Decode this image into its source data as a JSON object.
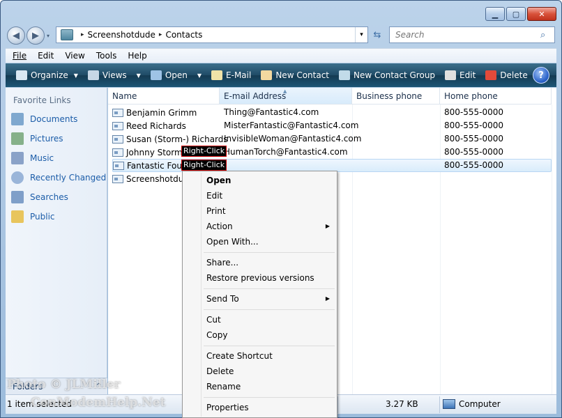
{
  "window": {
    "caption_buttons": {
      "minimize": "▁",
      "maximize": "▢",
      "close": "✕"
    }
  },
  "nav": {
    "back_icon": "◀",
    "forward_icon": "▶",
    "recent_caret": "▾"
  },
  "address": {
    "crumbs": [
      "Screenshotdude",
      "Contacts"
    ],
    "separator": "▸",
    "dropdown": "▾",
    "refresh_icon": "⇆"
  },
  "search": {
    "placeholder": "Search",
    "icon": "⌕"
  },
  "menubar": {
    "items": [
      "File",
      "Edit",
      "View",
      "Tools",
      "Help"
    ]
  },
  "commandbar": {
    "items": [
      {
        "label": "Organize",
        "dropdown": true,
        "icon_color": "#d9e7f2"
      },
      {
        "label": "Views",
        "dropdown": true,
        "icon_color": "#c7d7e6"
      },
      {
        "label": "Open",
        "dropdown": true,
        "icon_color": "#9ec3e6"
      },
      {
        "label": "E-Mail",
        "dropdown": false,
        "icon_color": "#f0e3a8"
      },
      {
        "label": "New Contact",
        "dropdown": false,
        "icon_color": "#f2d9a0"
      },
      {
        "label": "New Contact Group",
        "dropdown": false,
        "icon_color": "#c2dbe9"
      },
      {
        "label": "Edit",
        "dropdown": false,
        "icon_color": "#e0e0e0"
      },
      {
        "label": "Delete",
        "dropdown": false,
        "icon_color": "#e34a3a"
      }
    ],
    "more": "»",
    "help": "?"
  },
  "navpane": {
    "title": "Favorite Links",
    "links": [
      {
        "label": "Documents",
        "icon_color": "#7fa8cf"
      },
      {
        "label": "Pictures",
        "icon_color": "#86b18a"
      },
      {
        "label": "Music",
        "icon_color": "#8aa2c8"
      },
      {
        "label": "Recently Changed",
        "icon_color": "#9ab5d9"
      },
      {
        "label": "Searches",
        "icon_color": "#7f9fc9"
      },
      {
        "label": "Public",
        "icon_color": "#e8c55d"
      }
    ],
    "folders_label": "Folders",
    "folders_chevron": "^"
  },
  "columns": [
    "Name",
    "E-mail Address",
    "Business phone",
    "Home phone"
  ],
  "sort_indicator": "▲",
  "contacts": [
    {
      "name": "Benjamin Grimm",
      "email": "Thing@Fantastic4.com",
      "business": "",
      "home": "800-555-0000"
    },
    {
      "name": "Reed Richards",
      "email": "MisterFantastic@Fantastic4.com",
      "business": "",
      "home": "800-555-0000"
    },
    {
      "name": "Susan (Storm-) Richards",
      "email": "InvisibleWoman@Fantastic4.com",
      "business": "",
      "home": "800-555-0000"
    },
    {
      "name": "Johnny Storm",
      "email": "HumanTorch@Fantastic4.com",
      "business": "",
      "home": "800-555-0000"
    },
    {
      "name": "Fantastic Four",
      "email": "",
      "business": "",
      "home": "800-555-0000"
    },
    {
      "name": "Screenshotdude",
      "email": "",
      "business": "",
      "home": ""
    }
  ],
  "annotations": [
    "Right-Click",
    "Right-Click"
  ],
  "context_menu": [
    {
      "label": "Open",
      "bold": true
    },
    {
      "label": "Edit"
    },
    {
      "label": "Print"
    },
    {
      "label": "Action",
      "submenu": "▶"
    },
    {
      "label": "Open With..."
    },
    {
      "label": "Share..."
    },
    {
      "label": "Restore previous versions"
    },
    {
      "label": "Send To",
      "submenu": "▶"
    },
    {
      "label": "Cut"
    },
    {
      "label": "Copy"
    },
    {
      "label": "Create Shortcut"
    },
    {
      "label": "Delete"
    },
    {
      "label": "Rename"
    },
    {
      "label": "Properties"
    }
  ],
  "statusbar": {
    "selection": "1 item selected",
    "size": "3.27 KB",
    "location": "Computer"
  },
  "watermark": {
    "line1": "Photo © JLMiller",
    "line2": "ConModemHelp.Net"
  }
}
